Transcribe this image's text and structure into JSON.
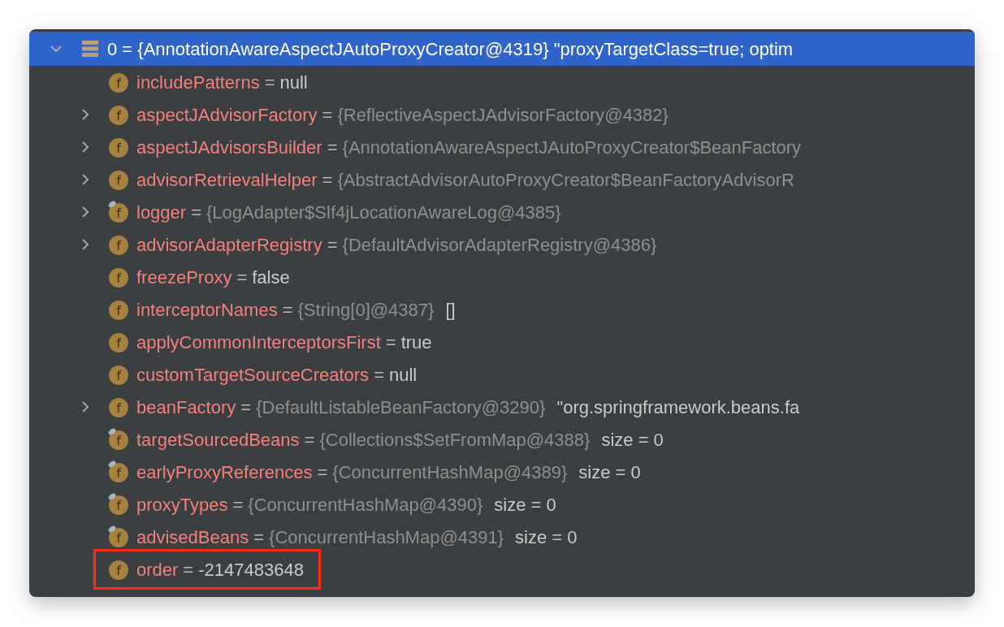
{
  "header": {
    "expanded": true,
    "selected": true,
    "name": "0",
    "sep": "=",
    "value": "{AnnotationAwareAspectJAutoProxyCreator@4319}",
    "extra": "\"proxyTargetClass=true; optim"
  },
  "rows": [
    {
      "icon": "f",
      "name": "includePatterns",
      "sep": "=",
      "value": "null",
      "kind": "primitive",
      "expandable": false,
      "marked": false,
      "highlighted": false
    },
    {
      "icon": "f",
      "name": "aspectJAdvisorFactory",
      "sep": "=",
      "value": "{ReflectiveAspectJAdvisorFactory@4382}",
      "kind": "object",
      "expandable": true,
      "marked": false,
      "highlighted": false
    },
    {
      "icon": "f",
      "name": "aspectJAdvisorsBuilder",
      "sep": "=",
      "value": "{AnnotationAwareAspectJAutoProxyCreator$BeanFactory",
      "kind": "object",
      "expandable": true,
      "marked": false,
      "highlighted": false
    },
    {
      "icon": "f",
      "name": "advisorRetrievalHelper",
      "sep": "=",
      "value": "{AbstractAdvisorAutoProxyCreator$BeanFactoryAdvisorR",
      "kind": "object",
      "expandable": true,
      "marked": false,
      "highlighted": false
    },
    {
      "icon": "f",
      "name": "logger",
      "sep": "=",
      "value": "{LogAdapter$Slf4jLocationAwareLog@4385}",
      "kind": "object",
      "expandable": true,
      "marked": true,
      "highlighted": false
    },
    {
      "icon": "f",
      "name": "advisorAdapterRegistry",
      "sep": "=",
      "value": "{DefaultAdvisorAdapterRegistry@4386}",
      "kind": "object",
      "expandable": true,
      "marked": false,
      "highlighted": false
    },
    {
      "icon": "f",
      "name": "freezeProxy",
      "sep": "=",
      "value": "false",
      "kind": "primitive",
      "expandable": false,
      "marked": false,
      "highlighted": false
    },
    {
      "icon": "f",
      "name": "interceptorNames",
      "sep": "=",
      "value": "{String[0]@4387}",
      "kind": "object",
      "extra": "[]",
      "expandable": false,
      "marked": false,
      "highlighted": false
    },
    {
      "icon": "f",
      "name": "applyCommonInterceptorsFirst",
      "sep": "=",
      "value": "true",
      "kind": "primitive",
      "expandable": false,
      "marked": false,
      "highlighted": false
    },
    {
      "icon": "f",
      "name": "customTargetSourceCreators",
      "sep": "=",
      "value": "null",
      "kind": "primitive",
      "expandable": false,
      "marked": false,
      "highlighted": false
    },
    {
      "icon": "f",
      "name": "beanFactory",
      "sep": "=",
      "value": "{DefaultListableBeanFactory@3290}",
      "kind": "object",
      "extra": "\"org.springframework.beans.fa",
      "expandable": true,
      "marked": false,
      "highlighted": false
    },
    {
      "icon": "f",
      "name": "targetSourcedBeans",
      "sep": "=",
      "value": "{Collections$SetFromMap@4388}",
      "kind": "object",
      "extra": "size = 0",
      "expandable": false,
      "marked": true,
      "highlighted": false
    },
    {
      "icon": "f",
      "name": "earlyProxyReferences",
      "sep": "=",
      "value": "{ConcurrentHashMap@4389}",
      "kind": "object",
      "extra": "size = 0",
      "expandable": false,
      "marked": true,
      "highlighted": false
    },
    {
      "icon": "f",
      "name": "proxyTypes",
      "sep": "=",
      "value": "{ConcurrentHashMap@4390}",
      "kind": "object",
      "extra": "size = 0",
      "expandable": false,
      "marked": true,
      "highlighted": false
    },
    {
      "icon": "f",
      "name": "advisedBeans",
      "sep": "=",
      "value": "{ConcurrentHashMap@4391}",
      "kind": "object",
      "extra": "size = 0",
      "expandable": false,
      "marked": true,
      "highlighted": false
    },
    {
      "icon": "f",
      "name": "order",
      "sep": "=",
      "value": "-2147483648",
      "kind": "primitive",
      "expandable": false,
      "marked": false,
      "highlighted": true
    }
  ]
}
